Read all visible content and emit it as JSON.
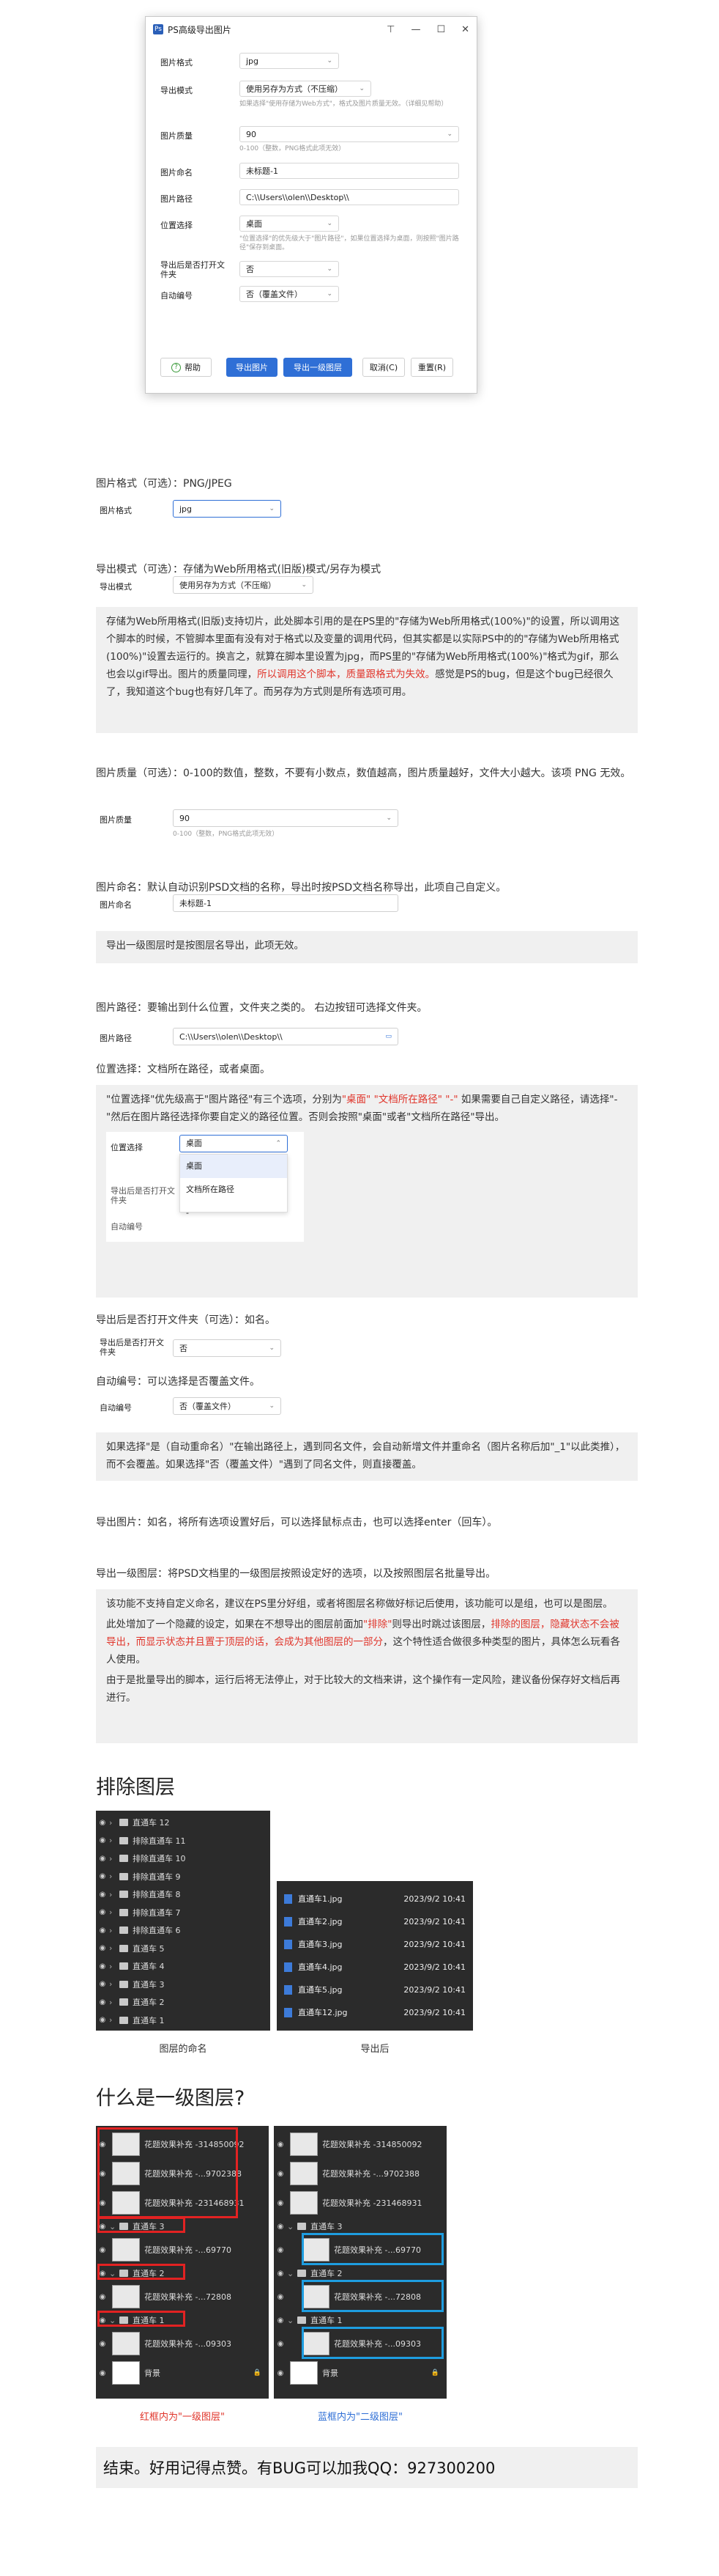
{
  "dialog": {
    "title": "PS高级导出图片",
    "rows": {
      "format": {
        "label": "图片格式",
        "value": "jpg"
      },
      "mode": {
        "label": "导出模式",
        "value": "使用另存为方式（不压缩）",
        "hint": "如果选择\"使用存储为Web方式\"，格式及图片质量无效。（详细见帮助）"
      },
      "quality": {
        "label": "图片质量",
        "value": "90",
        "hint": "0-100（整数，PNG格式此项无效）"
      },
      "name": {
        "label": "图片命名",
        "value": "未标题-1"
      },
      "path": {
        "label": "图片路径",
        "value": "C:\\\\Users\\\\olen\\\\Desktop\\\\"
      },
      "location": {
        "label": "位置选择",
        "value": "桌面",
        "hint": "\"位置选择\"的优先级大于\"图片路径\"，如果位置选择为桌面，则按照\"图片路径\"保存到桌面。"
      },
      "open_after": {
        "label": "导出后是否打开文件夹",
        "value": "否"
      },
      "auto_number": {
        "label": "自动编号",
        "value": "否（覆盖文件）"
      }
    },
    "buttons": {
      "help": "帮助",
      "export": "导出图片",
      "export_layer": "导出一级图层",
      "cancel": "取消(C)",
      "reset": "重置(R)"
    }
  },
  "doc": {
    "format_heading": "图片格式（可选）：PNG/JPEG",
    "format_label": "图片格式",
    "format_value": "jpg",
    "mode_heading": "导出模式（可选）：存储为Web所用格式(旧版)模式/另存为模式",
    "mode_label": "导出模式",
    "mode_value": "使用另存为方式（不压缩）",
    "mode_note_1": "存储为Web所用格式(旧版)支持切片，此处脚本引用的是在PS里的\"存储为Web所用格式(100%)\"的设置，所以调用这个脚本的时候，不管脚本里面有没有对于格式以及变量的调用代码，但其实都是以实际PS中的的\"存储为Web所用格式(100%)\"设置去运行的。换言之，就算在脚本里设置为jpg，而PS里的\"存储为Web所用格式(100%)\"格式为gif，那么也会以gif导出。图片的质量同理，",
    "mode_note_red": "所以调用这个脚本，质量跟格式为失效。",
    "mode_note_2": "感觉是PS的bug，但是这个bug已经很久了，我知道这个bug也有好几年了。而另存为方式则是所有选项可用。",
    "quality_heading": "图片质量（可选）：0-100的数值，整数，不要有小数点，数值越高，图片质量越好，文件大小越大。该项 PNG 无效。",
    "quality_label": "图片质量",
    "quality_value": "90",
    "quality_hint": "0-100（整数，PNG格式此项无效）",
    "name_heading": "图片命名：默认自动识别PSD文档的名称，导出时按PSD文档名称导出，此项自己自定义。",
    "name_label": "图片命名",
    "name_value": "未标题-1",
    "name_note": "导出一级图层时是按图层名导出，此项无效。",
    "path_heading": "图片路径：要输出到什么位置，文件夹之类的。 右边按钮可选择文件夹。",
    "path_label": "图片路径",
    "path_value": "C:\\\\Users\\\\olen\\\\Desktop\\\\",
    "location_heading": "位置选择：文档所在路径，或者桌面。",
    "location_note_1": "\"位置选择\"优先级高于\"图片路径\"有三个选项，分别为",
    "location_note_opt1": "\"桌面\"",
    "location_note_opt2": "\"文档所在路径\"",
    "location_note_opt3": "\"-\"",
    "location_note_2": "如果需要自己自定义路径，请选择\"-\"然后在图片路径选择你要自定义的路径位置。否则会按照\"桌面\"或者\"文档所在路径\"导出。",
    "dropdown": {
      "label": "位置选择",
      "value": "桌面",
      "options": [
        "桌面",
        "文档所在路径",
        "-"
      ],
      "behind_1": "导出后是否打开文件夹",
      "behind_2": "自动编号"
    },
    "open_heading": "导出后是否打开文件夹（可选）：如名。",
    "open_label": "导出后是否打开文件夹",
    "open_value": "否",
    "auto_heading": "自动编号：可以选择是否覆盖文件。",
    "auto_label": "自动编号",
    "auto_value": "否（覆盖文件）",
    "auto_note": "如果选择\"是（自动重命名）\"在输出路径上，遇到同名文件，会自动新增文件并重命名（图片名称后加\"_1\"以此类推），而不会覆盖。如果选择\"否（覆盖文件）\"遇到了同名文件，则直接覆盖。",
    "export_heading": "导出图片：如名，将所有选项设置好后，可以选择鼠标点击，也可以选择enter（回车）。",
    "layer_heading": "导出一级图层：将PSD文档里的一级图层按照设定好的选项，以及按照图层名批量导出。",
    "layer_note_1": "该功能不支持自定义命名，建议在PS里分好组，或者将图层名称做好标记后使用，该功能可以是组，也可以是图层。",
    "layer_note_2a": "此处增加了一个隐藏的设定，如果在不想导出的图层前面加",
    "layer_note_2red1": "\"排除\"",
    "layer_note_2b": "则导出时跳过该图层，",
    "layer_note_2red2": "排除的图层，隐藏状态不会被导出，而显示状态并且置于顶层的话，会成为其他图层的一部分",
    "layer_note_2c": "，这个特性适合做很多种类型的图片，具体怎么玩看各人使用。",
    "layer_note_3": "由于是批量导出的脚本，运行后将无法停止，对于比较大的文档来讲，这个操作有一定风险，建议备份保存好文档后再进行。"
  },
  "exclude": {
    "title": "排除图层",
    "layers": [
      "直通车 12",
      "排除直通车 11",
      "排除直通车 10",
      "排除直通车 9",
      "排除直通车 8",
      "排除直通车 7",
      "排除直通车 6",
      "直通车 5",
      "直通车 4",
      "直通车 3",
      "直通车 2",
      "直通车 1"
    ],
    "files": [
      {
        "name": "直通车1.jpg",
        "date": "2023/9/2 10:41"
      },
      {
        "name": "直通车2.jpg",
        "date": "2023/9/2 10:41"
      },
      {
        "name": "直通车3.jpg",
        "date": "2023/9/2 10:41"
      },
      {
        "name": "直通车4.jpg",
        "date": "2023/9/2 10:41"
      },
      {
        "name": "直通车5.jpg",
        "date": "2023/9/2 10:41"
      },
      {
        "name": "直通车12.jpg",
        "date": "2023/9/2 10:41"
      }
    ],
    "caption_left": "图层的命名",
    "caption_right": "导出后"
  },
  "level": {
    "title": "什么是一级图层?",
    "left": [
      {
        "type": "layer",
        "name": "花题效果补充 -314850092"
      },
      {
        "type": "layer",
        "name": "花题效果补充 -...9702388"
      },
      {
        "type": "layer",
        "name": "花题效果补充 -231468931"
      },
      {
        "type": "group",
        "name": "直通车 3"
      },
      {
        "type": "layer",
        "name": "花题效果补充 -...69770"
      },
      {
        "type": "group",
        "name": "直通车 2"
      },
      {
        "type": "layer",
        "name": "花题效果补充 -...72808"
      },
      {
        "type": "group",
        "name": "直通车 1"
      },
      {
        "type": "layer",
        "name": "花题效果补充 -...09303"
      },
      {
        "type": "bg",
        "name": "背景"
      }
    ],
    "right": [
      {
        "type": "layer",
        "name": "花题效果补充 -314850092"
      },
      {
        "type": "layer",
        "name": "花题效果补充 -...9702388"
      },
      {
        "type": "layer",
        "name": "花题效果补充 -231468931"
      },
      {
        "type": "group",
        "name": "直通车 3"
      },
      {
        "type": "layer",
        "name": "花题效果补充 -...69770"
      },
      {
        "type": "group",
        "name": "直通车 2"
      },
      {
        "type": "layer",
        "name": "花题效果补充 -...72808"
      },
      {
        "type": "group",
        "name": "直通车 1"
      },
      {
        "type": "layer",
        "name": "花题效果补充 -...09303"
      },
      {
        "type": "bg",
        "name": "背景"
      }
    ],
    "caption_left": "红框内为\"一级图层\"",
    "caption_right": "蓝框内为\"二级图层\""
  },
  "footer": "结束。好用记得点赞。有BUG可以加我QQ：927300200",
  "colors": {
    "red": "#e0352b",
    "blue": "#2f6fd6",
    "panel": "#2b2b2b"
  }
}
